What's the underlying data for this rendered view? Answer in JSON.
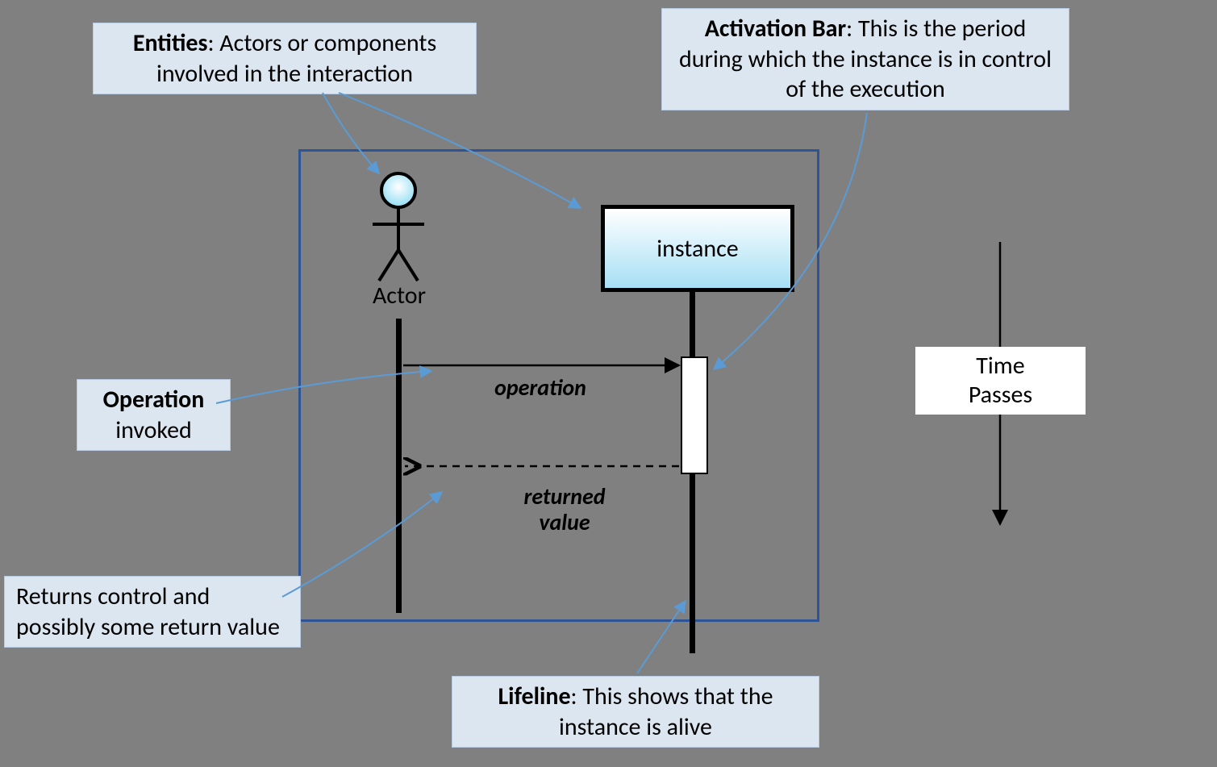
{
  "callouts": {
    "entities": {
      "bold": "Entities",
      "rest": ":  Actors or components involved in the interaction"
    },
    "activation": {
      "bold": "Activation Bar",
      "rest": ": This is the period during which the instance is in control of the execution"
    },
    "operation": {
      "bold": "Operation",
      "rest": "invoked"
    },
    "returns": {
      "text": "Returns control and possibly some return value"
    },
    "lifeline": {
      "bold": "Lifeline",
      "rest": ": This shows that the instance is alive"
    }
  },
  "time_box": {
    "line1": "Time",
    "line2": "Passes"
  },
  "diagram": {
    "actor_label": "Actor",
    "instance_label": "instance",
    "operation_label": "operation",
    "return_label_line1": "returned",
    "return_label_line2": "value"
  }
}
